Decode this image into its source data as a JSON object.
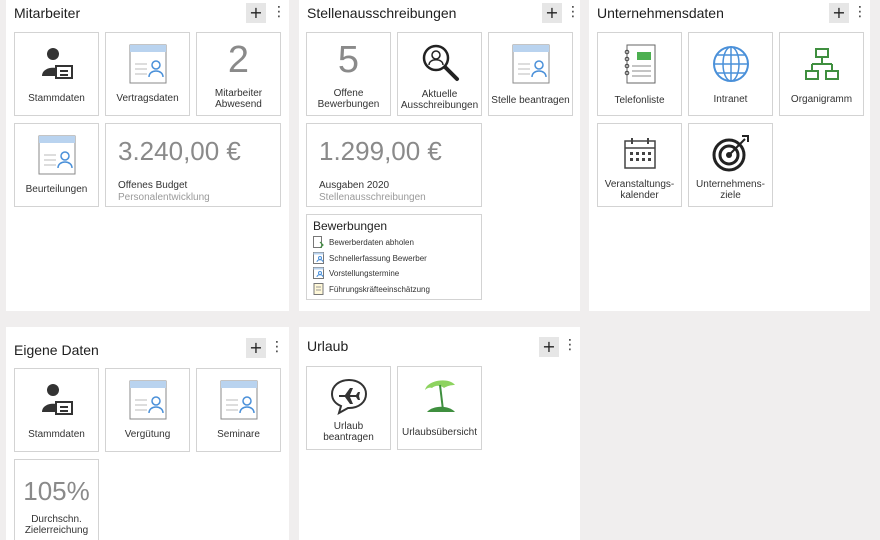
{
  "panels": {
    "mitarbeiter": {
      "title": "Mitarbeiter",
      "add": "+",
      "more": "⋮",
      "tiles": {
        "stammdaten": "Stammdaten",
        "vertragsdaten": "Vertragsdaten",
        "abwesend_count": "2",
        "abwesend_label": "Mitarbeiter\nAbwesend",
        "beurteilungen": "Beurteilungen",
        "budget_amount": "3.240,00 €",
        "budget_label": "Offenes Budget",
        "budget_sub": "Personalentwicklung"
      }
    },
    "stellen": {
      "title": "Stellenausschreibungen",
      "add": "+",
      "more": "⋮",
      "tiles": {
        "offene_count": "5",
        "offene_label": "Offene\nBewerbungen",
        "aktuelle": "Aktuelle\nAusschreibungen",
        "beantragen": "Stelle beantragen",
        "ausgaben_amount": "1.299,00 €",
        "ausgaben_label": "Ausgaben 2020",
        "ausgaben_sub": "Stellenausschreibungen"
      },
      "bewerbungen": {
        "title": "Bewerbungen",
        "items": [
          "Bewerberdaten abholen",
          "Schnellerfassung Bewerber",
          "Vorstellungstermine",
          "Führungskräfteeinschätzung"
        ]
      }
    },
    "unternehmen": {
      "title": "Unternehmensdaten",
      "add": "+",
      "more": "⋮",
      "tiles": {
        "telefonliste": "Telefonliste",
        "intranet": "Intranet",
        "organigramm": "Organigramm",
        "kalender": "Veranstaltungs-\nkalender",
        "ziele": "Unternehmens-\nziele"
      }
    },
    "eigene": {
      "title": "Eigene Daten",
      "add": "+",
      "more": "⋮",
      "tiles": {
        "stammdaten": "Stammdaten",
        "verguetung": "Vergütung",
        "seminare": "Seminare",
        "ziel_pct": "105%",
        "ziel_label": "Durchschn.\nZielerreichung"
      }
    },
    "urlaub": {
      "title": "Urlaub",
      "add": "+",
      "more": "⋮",
      "tiles": {
        "beantragen": "Urlaub\nbeantragen",
        "uebersicht": "Urlaubsübersicht"
      }
    }
  },
  "icons": {
    "person_card": "person-card-icon",
    "document_person": "document-person-icon",
    "magnifier": "magnifier-icon",
    "notebook": "notebook-icon",
    "globe": "globe-icon",
    "org_chart": "org-chart-icon",
    "calendar": "calendar-icon",
    "target": "target-icon",
    "plane_bubble": "plane-bubble-icon",
    "beach_umbrella": "beach-umbrella-icon"
  },
  "colors": {
    "background": "#f0eeee",
    "panel": "#ffffff",
    "tile_border": "#d3d3d3",
    "big_number": "#8a8a8a",
    "doc_blue": "#4a90d9",
    "green": "#3f8f3f",
    "light_green": "#8dd35f"
  }
}
